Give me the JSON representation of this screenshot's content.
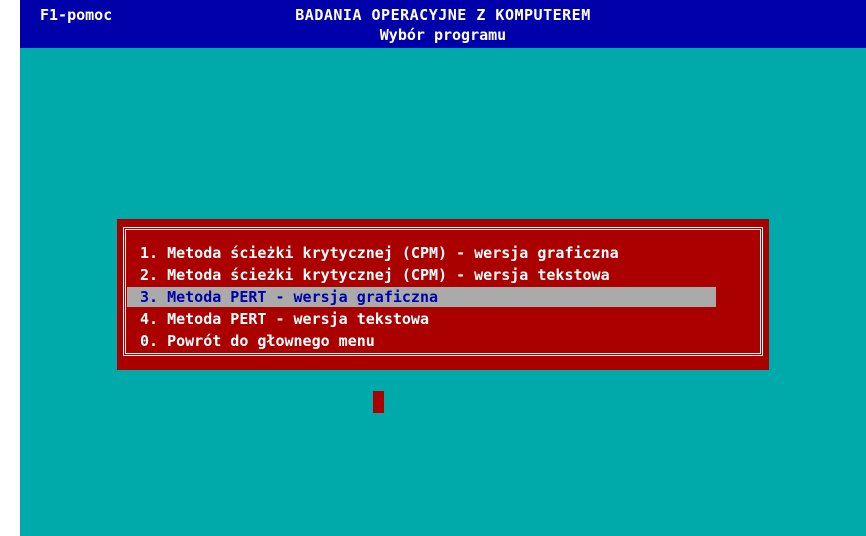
{
  "header": {
    "help_hint": "F1-pomoc",
    "title": "BADANIA OPERACYJNE Z KOMPUTEREM",
    "subtitle": "Wybór programu"
  },
  "menu": {
    "items": [
      {
        "label": "1. Metoda ścieżki krytycznej (CPM) - wersja graficzna",
        "selected": false
      },
      {
        "label": "2. Metoda ścieżki krytycznej (CPM) - wersja tekstowa",
        "selected": false
      },
      {
        "label": "3. Metoda PERT - wersja graficzna",
        "selected": true
      },
      {
        "label": "4. Metoda PERT - wersja tekstowa",
        "selected": false
      },
      {
        "label": "0. Powrót do głownego menu",
        "selected": false
      }
    ]
  },
  "colors": {
    "background": "#00aaaa",
    "header": "#0000aa",
    "menu_panel": "#aa0000",
    "highlight": "#aaaaaa",
    "text": "#ffffff",
    "selected_text": "#0000aa"
  }
}
